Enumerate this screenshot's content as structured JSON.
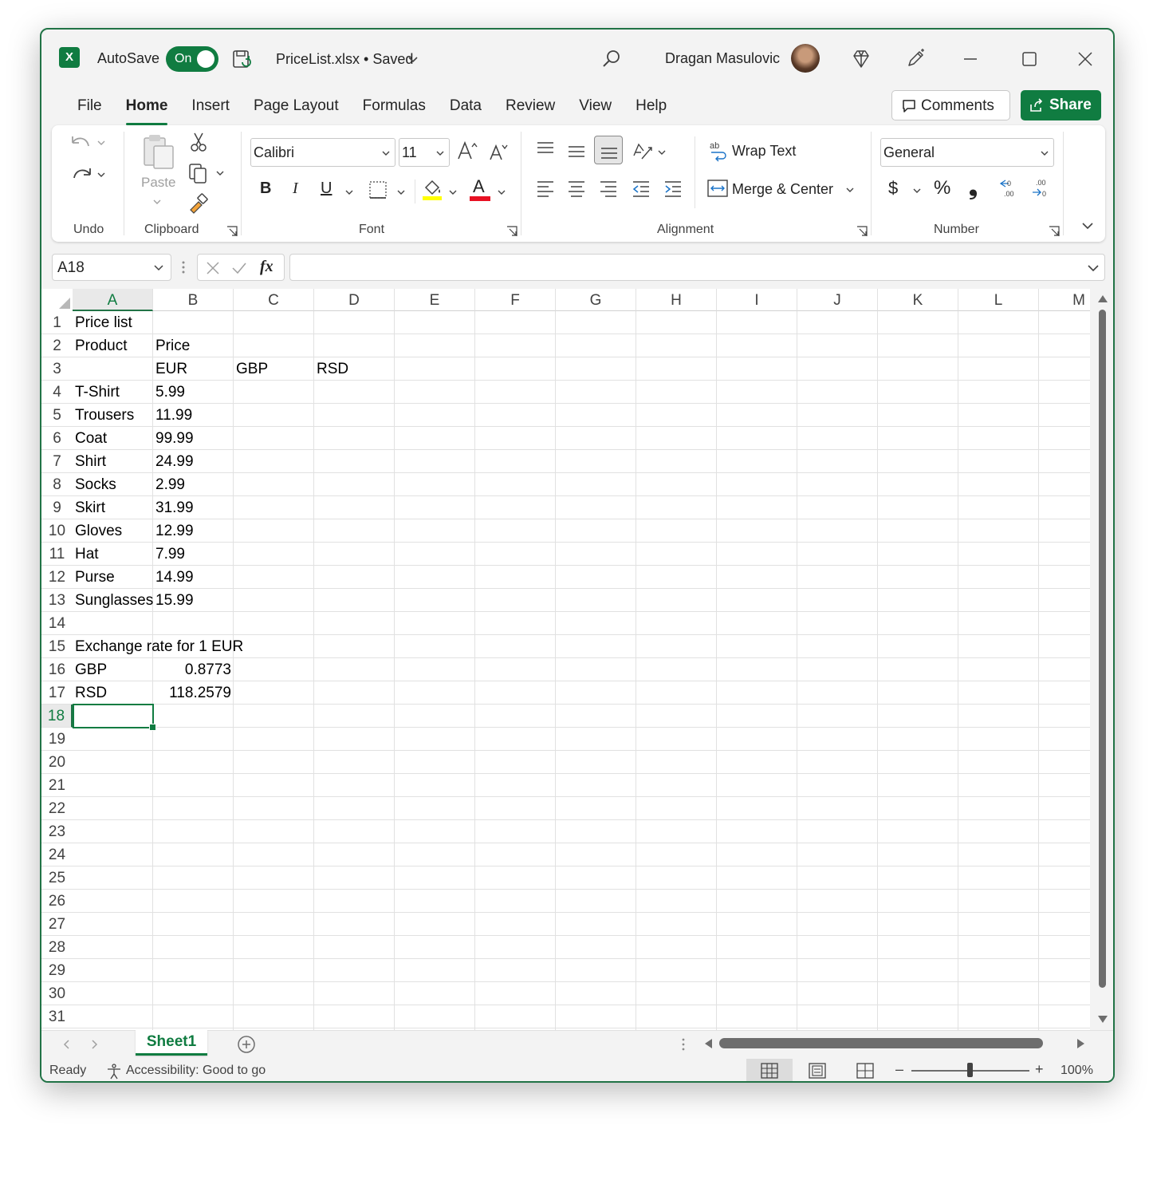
{
  "titlebar": {
    "app_badge": "X",
    "autosave_label": "AutoSave",
    "autosave_state": "On",
    "filename": "PriceList.xlsx • Saved",
    "user_name": "Dragan Masulovic"
  },
  "tabs": [
    "File",
    "Home",
    "Insert",
    "Page Layout",
    "Formulas",
    "Data",
    "Review",
    "View",
    "Help"
  ],
  "active_tab": "Home",
  "actions": {
    "comments": "Comments",
    "share": "Share"
  },
  "ribbon": {
    "undo_group": "Undo",
    "clipboard_group": "Clipboard",
    "paste_label": "Paste",
    "font_group": "Font",
    "font_name": "Calibri",
    "font_size": "11",
    "bold": "B",
    "italic": "I",
    "underline": "U",
    "font_color_glyph": "A",
    "alignment_group": "Alignment",
    "wrap_text": "Wrap Text",
    "merge_center": "Merge & Center",
    "number_group": "Number",
    "number_format": "General",
    "currency_glyph": "$",
    "percent_glyph": "%",
    "comma_glyph": "❟",
    "accents": {
      "fill_yellow": "#ffff00",
      "font_red": "#e81123"
    }
  },
  "formula_bar": {
    "name_box": "A18",
    "fx": "fx",
    "formula": ""
  },
  "columns": [
    "A",
    "B",
    "C",
    "D",
    "E",
    "F",
    "G",
    "H",
    "I",
    "J",
    "K",
    "L",
    "M"
  ],
  "selected_column": "A",
  "rows": [
    "1",
    "2",
    "3",
    "4",
    "5",
    "6",
    "7",
    "8",
    "9",
    "10",
    "11",
    "12",
    "13",
    "14",
    "15",
    "16",
    "17",
    "18",
    "19",
    "20",
    "21",
    "22",
    "23",
    "24",
    "25",
    "26",
    "27",
    "28",
    "29",
    "30",
    "31"
  ],
  "selected_row": "18",
  "cells": {
    "r1": {
      "a": "Price list"
    },
    "r2": {
      "a": "Product",
      "b": "Price"
    },
    "r3": {
      "b": "EUR",
      "c": "GBP",
      "d": "RSD"
    },
    "r4": {
      "a": "T-Shirt",
      "b": "5.99"
    },
    "r5": {
      "a": "Trousers",
      "b": "11.99"
    },
    "r6": {
      "a": "Coat",
      "b": "99.99"
    },
    "r7": {
      "a": "Shirt",
      "b": "24.99"
    },
    "r8": {
      "a": "Socks",
      "b": "2.99"
    },
    "r9": {
      "a": "Skirt",
      "b": "31.99"
    },
    "r10": {
      "a": "Gloves",
      "b": "12.99"
    },
    "r11": {
      "a": "Hat",
      "b": "7.99"
    },
    "r12": {
      "a": "Purse",
      "b": "14.99"
    },
    "r13": {
      "a": "Sunglasses",
      "b": "15.99"
    },
    "r15": {
      "a": "Exchange rate for 1 EUR"
    },
    "r16": {
      "a": "GBP",
      "b": "0.8773"
    },
    "r17": {
      "a": "RSD",
      "b": "118.2579"
    }
  },
  "sheets": {
    "active": "Sheet1"
  },
  "status": {
    "ready": "Ready",
    "accessibility": "Accessibility: Good to go",
    "zoom_minus": "–",
    "zoom_plus": "+",
    "zoom": "100%"
  }
}
